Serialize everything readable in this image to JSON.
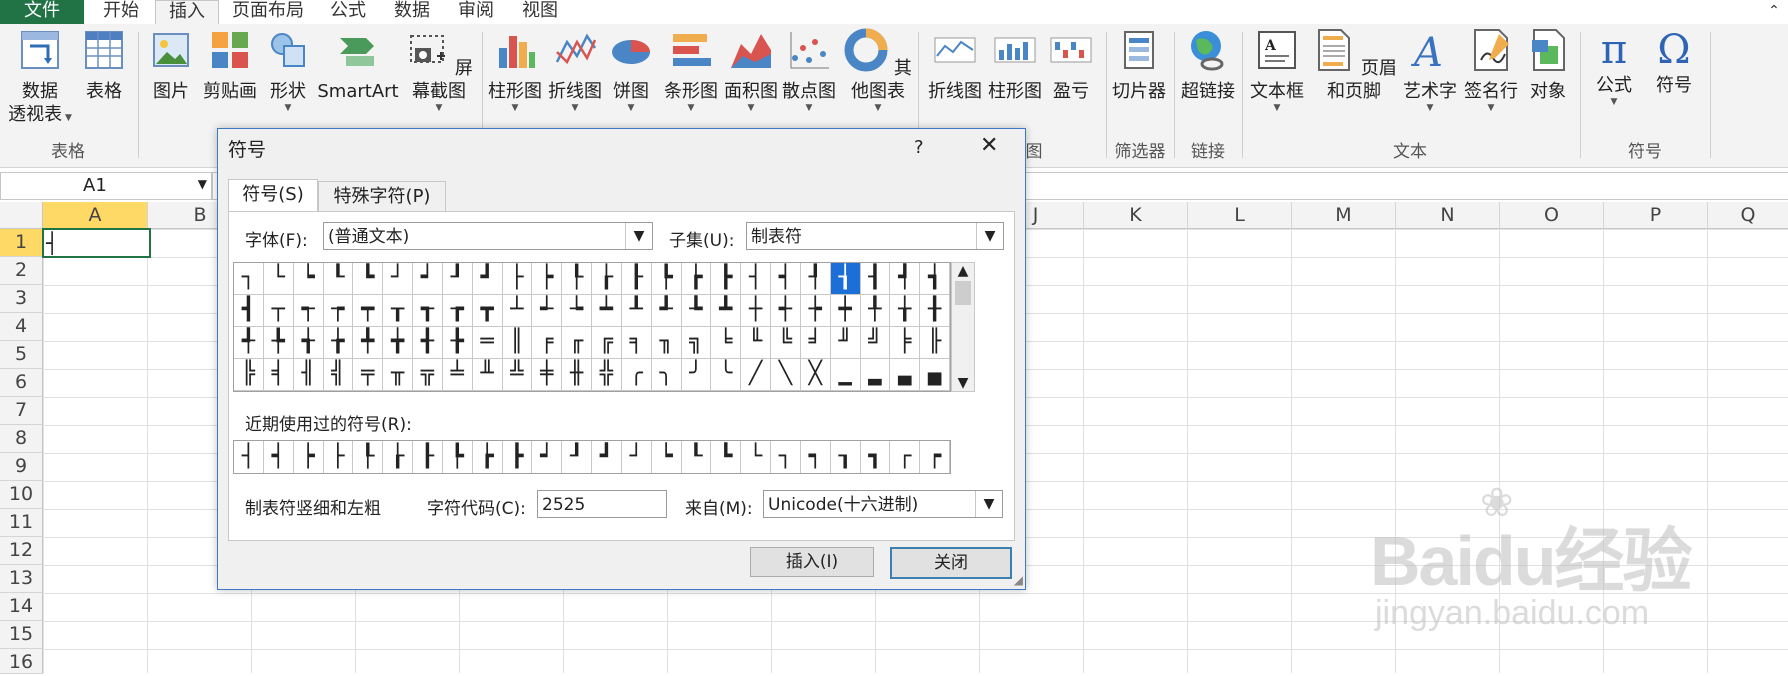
{
  "menu": {
    "tabs": [
      "文件",
      "开始",
      "插入",
      "页面布局",
      "公式",
      "数据",
      "审阅",
      "视图"
    ],
    "active": "插入"
  },
  "ribbon": {
    "buttons": {
      "pivot": "数据\n透视表",
      "table": "表格",
      "picture": "图片",
      "clipart": "剪贴画",
      "shapes": "形状",
      "smartart": "SmartArt",
      "screenshot": "屏幕截图",
      "column": "柱形图",
      "line": "折线图",
      "pie": "饼图",
      "bar": "条形图",
      "area": "面积图",
      "scatter": "散点图",
      "other": "其他图表",
      "spark_line": "折线图",
      "spark_column": "柱形图",
      "spark_winloss": "盈亏",
      "slicer": "切片器",
      "hyperlink": "超链接",
      "textbox": "文本框",
      "header_footer": "页眉和页脚",
      "wordart": "艺术字",
      "signature": "签名行",
      "object": "对象",
      "equation": "公式",
      "symbol": "符号"
    },
    "groups": {
      "tables": "表格",
      "charts_tail": "图",
      "filter": "筛选器",
      "links": "链接",
      "text": "文本",
      "symbols": "符号"
    }
  },
  "namebox": "A1",
  "columns": [
    "A",
    "B",
    "J",
    "K",
    "L",
    "M",
    "N",
    "O",
    "P",
    "Q"
  ],
  "rows": [
    "1",
    "2",
    "3",
    "4",
    "5",
    "6",
    "7",
    "8",
    "9",
    "10",
    "11",
    "12",
    "13",
    "14",
    "15",
    "16"
  ],
  "cell_a1": "┤",
  "dialog": {
    "title": "符号",
    "help": "?",
    "close": "✕",
    "tabs": [
      "符号(S)",
      "特殊字符(P)"
    ],
    "font_label": "字体(F):",
    "font_value": "(普通文本)",
    "subset_label": "子集(U):",
    "subset_value": "制表符",
    "symbols": [
      "┐",
      "└",
      "┕",
      "┖",
      "┗",
      "┘",
      "┙",
      "┚",
      "┛",
      "├",
      "┝",
      "┞",
      "┟",
      "┠",
      "┡",
      "┢",
      "┣",
      "┤",
      "┥",
      "┦",
      "┧",
      "┨",
      "┩",
      "┪",
      "┫",
      "┬",
      "┭",
      "┮",
      "┯",
      "┰",
      "┱",
      "┲",
      "┳",
      "┴",
      "┵",
      "┶",
      "┷",
      "┸",
      "┹",
      "┺",
      "┻",
      "┼",
      "┽",
      "┾",
      "┿",
      "╀",
      "╁",
      "╂",
      "╃",
      "╄",
      "╅",
      "╆",
      "╇",
      "╈",
      "╉",
      "╊",
      "═",
      "║",
      "╒",
      "╓",
      "╔",
      "╕",
      "╖",
      "╗",
      "╘",
      "╙",
      "╚",
      "╛",
      "╜",
      "╝",
      "╞",
      "╟",
      "╠",
      "╡",
      "╢",
      "╣",
      "╤",
      "╥",
      "╦",
      "╧",
      "╨",
      "╩",
      "╪",
      "╫",
      "╬",
      "╭",
      "╮",
      "╯",
      "╰",
      "╱",
      "╲",
      "╳",
      "▁",
      "▂",
      "▃",
      "▄"
    ],
    "selected_index": 20,
    "recent_label": "近期使用过的符号(R):",
    "recent": [
      "┤",
      "┥",
      "┝",
      "├",
      "┞",
      "┟",
      "┠",
      "┡",
      "┢",
      "┣",
      "┙",
      "┚",
      "┛",
      "┘",
      "┕",
      "┖",
      "┗",
      "└",
      "┐",
      "┑",
      "┒",
      "┓",
      "┌",
      "┍"
    ],
    "char_name": "制表符竖细和左粗",
    "code_label": "字符代码(C):",
    "code_value": "2525",
    "from_label": "来自(M):",
    "from_value": "Unicode(十六进制)",
    "insert": "插入(I)",
    "close_btn": "关闭"
  },
  "watermark": {
    "logo": "Baidu经验",
    "url": "jingyan.baidu.com"
  },
  "colors": {
    "excel_green": "#217346",
    "selection_blue": "#1b6fd6",
    "dialog_border": "#3d79c7"
  }
}
